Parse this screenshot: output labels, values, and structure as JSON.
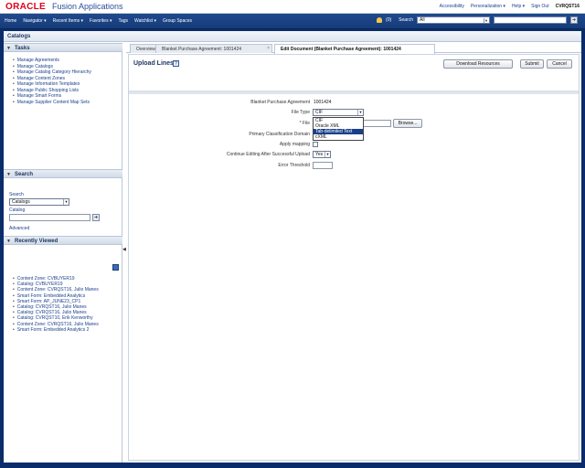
{
  "brand": {
    "logo": "ORACLE",
    "app_name": "Fusion Applications"
  },
  "top_links": {
    "accessibility": "Accessibility",
    "personalization": "Personalization ▾",
    "help": "Help ▾",
    "sign_out": "Sign Out",
    "user": "CVRQST16"
  },
  "nav": {
    "items": [
      "Home",
      "Navigator ▾",
      "Recent Items ▾",
      "Favorites ▾",
      "Tags",
      "Watchlist ▾",
      "Group Spaces"
    ],
    "notifications": "(0)",
    "search_label": "Search",
    "search_scope": "All"
  },
  "page_title": "Catalogs",
  "tasks": {
    "title": "Tasks",
    "items": [
      "Manage Agreements",
      "Manage Catalogs",
      "Manage Catalog Category Hierarchy",
      "Manage Content Zones",
      "Manage Information Templates",
      "Manage Public Shopping Lists",
      "Manage Smart Forms",
      "Manage Supplier Content Map Sets"
    ]
  },
  "search_panel": {
    "title": "Search",
    "search_label": "Search",
    "search_type": "Catalogs",
    "catalog_label": "Catalog",
    "catalog_value": "",
    "advanced": "Advanced"
  },
  "recent": {
    "title": "Recently Viewed",
    "items": [
      "Content Zone: CVBUYER19",
      "Catalog: CVBUYER19",
      "Content Zone: CVRQST16, Julio Manes",
      "Smart Form: Embedded Analytics",
      "Smart Form: AP_JUNE23_CP1",
      "Catalog: CVRQST16, Julio Manes",
      "Catalog: CVRQST16, Julio Manes",
      "Catalog: CVRQST10, Erik Kenworthy",
      "Content Zone: CVRQST16, Julio Manes",
      "Smart Form: Embedded Analytics 2"
    ]
  },
  "tabs": [
    {
      "label": "Overview"
    },
    {
      "label": "Blanket Purchase Agreement: 1001424"
    },
    {
      "label": "Edit Document (Blanket Purchase Agreement): 1001424"
    }
  ],
  "upload": {
    "title": "Upload Lines",
    "help": "?",
    "download_resources": "Download Resources",
    "submit": "Submit",
    "cancel": "Cancel"
  },
  "form": {
    "bpa_label": "Blanket Purchase Agreement",
    "bpa_value": "1001424",
    "file_type_label": "File Type",
    "file_type_value": "CIF",
    "file_type_options": [
      "CIF",
      "Oracle XML",
      "Tab-delimited Text",
      "cXML"
    ],
    "file_type_highlighted": "Tab-delimited Text",
    "file_label": "* File",
    "browse": "Browse...",
    "primary_classification_label": "Primary Classification Domain",
    "apply_mapping_label": "Apply mapping",
    "continue_label": "Continue Editing After Successful Upload",
    "continue_value": "Yes",
    "error_threshold_label": "Error Threshold",
    "error_threshold_value": ""
  }
}
